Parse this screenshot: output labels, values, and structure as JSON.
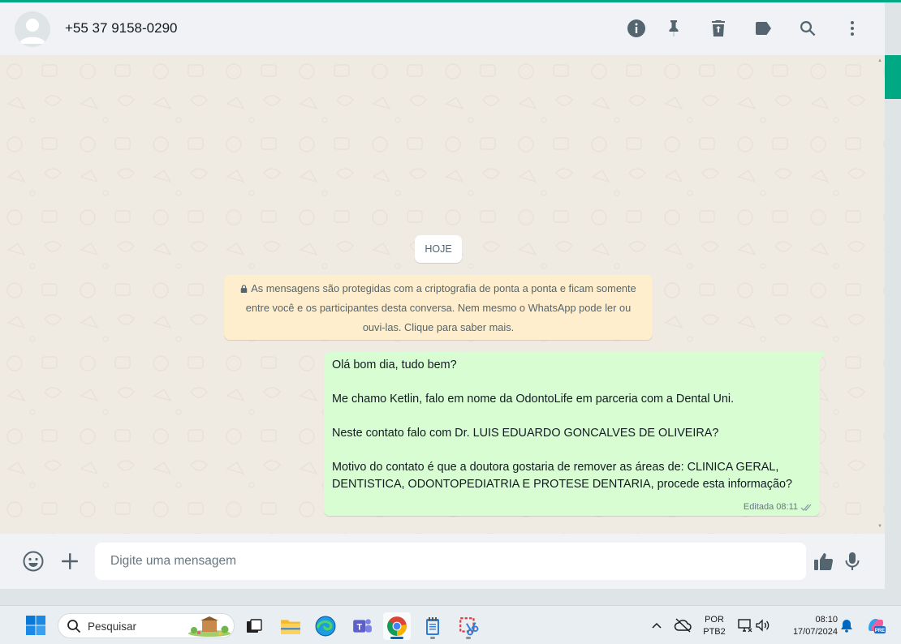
{
  "header": {
    "contact_name": "+55 37 9158-0290",
    "icons": [
      "info-icon",
      "pin-icon",
      "delete-icon",
      "label-icon",
      "search-icon",
      "menu-icon"
    ]
  },
  "chat": {
    "day_label": "HOJE",
    "encryption_notice": "As mensagens são protegidas com a criptografia de ponta a ponta e ficam somente entre você e os participantes desta conversa. Nem mesmo o WhatsApp pode ler ou ouvi-las. Clique para saber mais.",
    "message": {
      "lines": [
        "Olá bom dia, tudo bem?",
        "Me chamo Ketlin, falo em nome da OdontoLife em parceria com a Dental Uni.",
        "Neste contato falo com Dr. LUIS EDUARDO GONCALVES DE OLIVEIRA?",
        "Motivo do contato é que a doutora gostaria de remover as áreas de: CLINICA GERAL, DENTISTICA, ODONTOPEDIATRIA E PROTESE DENTARIA, procede esta informação?"
      ],
      "status": "Editada 08:11",
      "status_icon": "double-check-icon"
    }
  },
  "composer": {
    "placeholder": "Digite uma mensagem",
    "value": ""
  },
  "taskbar": {
    "search_label": "Pesquisar",
    "language_line1": "POR",
    "language_line2": "PTB2",
    "time": "08:10",
    "date": "17/07/2024",
    "copilot_badge": "PRE"
  },
  "colors": {
    "accent": "#00a884",
    "outgoing_bubble": "#d9fdd3",
    "notice_bg": "#ffeecd",
    "chat_bg": "#efeae2",
    "header_bg": "#f0f2f5"
  }
}
